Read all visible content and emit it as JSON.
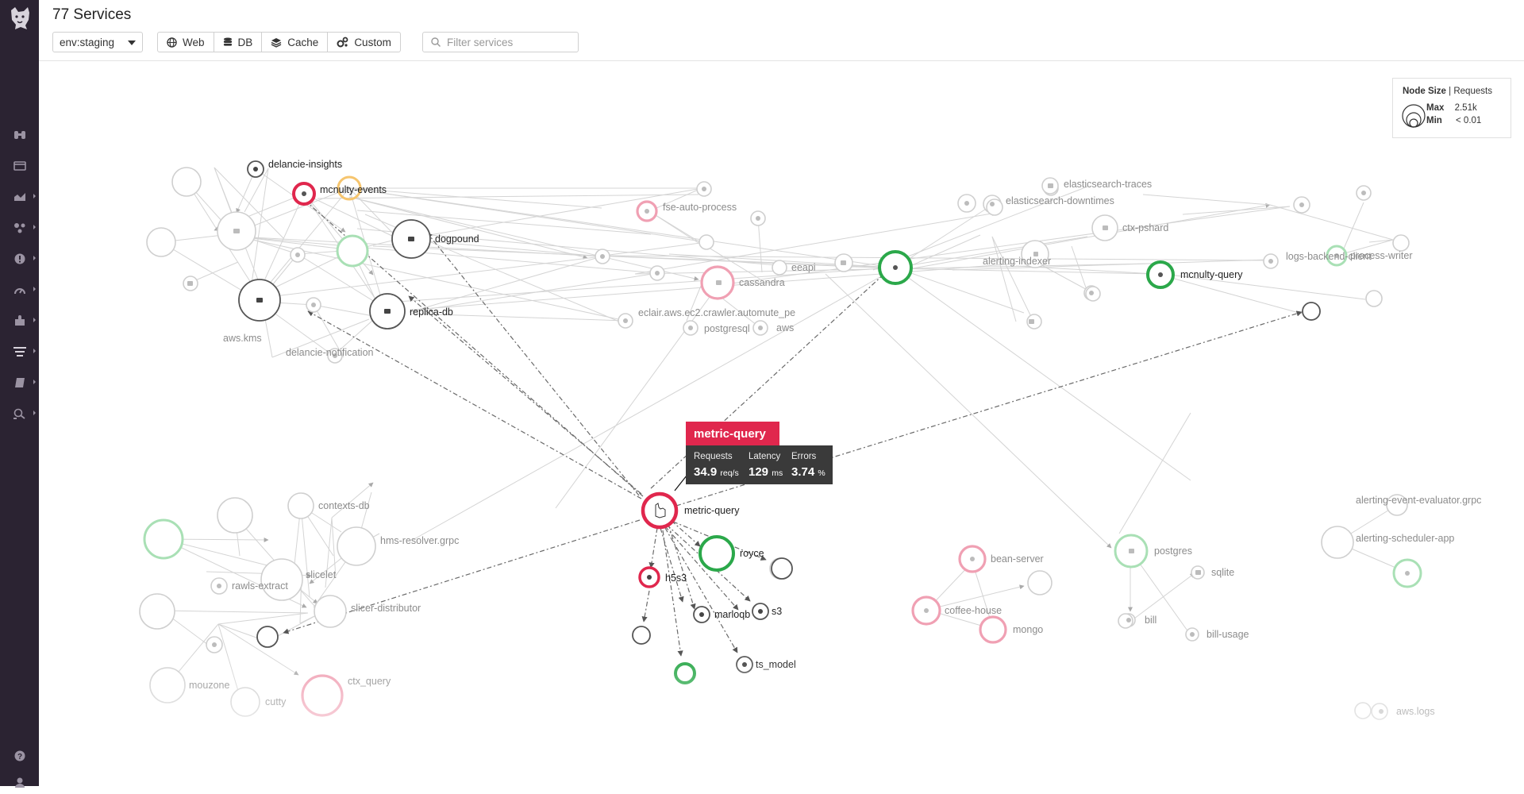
{
  "sidebar": {
    "logo": "dog-logo-icon",
    "items": [
      {
        "icon": "binoculars-icon"
      },
      {
        "icon": "dashboard-icon"
      },
      {
        "icon": "infrastructure-icon"
      },
      {
        "icon": "apm-icon"
      },
      {
        "icon": "monitors-icon"
      },
      {
        "icon": "gauge-icon"
      },
      {
        "icon": "integrations-icon"
      },
      {
        "icon": "logs-icon"
      },
      {
        "icon": "notebook-icon"
      },
      {
        "icon": "synthetics-icon"
      }
    ],
    "help_icon": "help-icon"
  },
  "header": {
    "title": "77 Services",
    "env": "env:staging",
    "filters": [
      {
        "label": "Web",
        "icon": "globe-icon"
      },
      {
        "label": "DB",
        "icon": "database-icon"
      },
      {
        "label": "Cache",
        "icon": "layers-icon"
      },
      {
        "label": "Custom",
        "icon": "gears-icon"
      }
    ],
    "search_placeholder": "Filter services"
  },
  "legend": {
    "title": "Node Size",
    "metric": "Requests",
    "max_label": "Max",
    "max_value": "2.51k",
    "min_label": "Min",
    "min_value": "< 0.01"
  },
  "tooltip": {
    "service": "metric-query",
    "requests_label": "Requests",
    "requests_value": "34.9",
    "requests_unit": "req/s",
    "latency_label": "Latency",
    "latency_value": "129",
    "latency_unit": "ms",
    "errors_label": "Errors",
    "errors_value": "3.74",
    "errors_unit": "%"
  },
  "colors": {
    "sidebar": "#2b2332",
    "red": "#e0274d",
    "green": "#2ba84a",
    "orange": "#f5b246",
    "gray": "#8c8c8c"
  },
  "nodes": [
    {
      "label": "delancie-insights",
      "type": "custom",
      "status": "neutral"
    },
    {
      "label": "mcnulty-events",
      "type": "web",
      "status": "error"
    },
    {
      "label": "dogpound",
      "type": "db",
      "status": "neutral"
    },
    {
      "label": "replica-db",
      "type": "db",
      "status": "neutral"
    },
    {
      "label": "aws.kms",
      "type": "web",
      "status": "neutral"
    },
    {
      "label": "delancie-notification",
      "type": "custom",
      "status": "neutral"
    },
    {
      "label": "fse-auto-process",
      "type": "custom",
      "status": "error"
    },
    {
      "label": "eeapi",
      "type": "custom",
      "status": "neutral"
    },
    {
      "label": "cassandra",
      "type": "db",
      "status": "error"
    },
    {
      "label": "eclair.aws.ec2.crawler.automute_pe",
      "type": "custom",
      "status": "neutral"
    },
    {
      "label": "postgresql",
      "type": "db",
      "status": "neutral"
    },
    {
      "label": "aws",
      "type": "web",
      "status": "neutral"
    },
    {
      "label": "elasticsearch-downtimes",
      "type": "custom",
      "status": "neutral"
    },
    {
      "label": "elasticsearch-traces",
      "type": "db",
      "status": "neutral"
    },
    {
      "label": "ctx-pshard",
      "type": "db",
      "status": "neutral"
    },
    {
      "label": "alerting-indexer",
      "type": "custom",
      "status": "neutral"
    },
    {
      "label": "mcnulty-query",
      "type": "web",
      "status": "ok"
    },
    {
      "label": "logs-backend-client",
      "type": "web",
      "status": "neutral"
    },
    {
      "label": "process-writer",
      "type": "custom",
      "status": "ok"
    },
    {
      "label": "metric-query",
      "type": "web",
      "status": "error"
    },
    {
      "label": "royce",
      "type": "web",
      "status": "ok"
    },
    {
      "label": "h5s3",
      "type": "custom",
      "status": "error"
    },
    {
      "label": "marloqb",
      "type": "custom",
      "status": "neutral"
    },
    {
      "label": "s3",
      "type": "custom",
      "status": "neutral"
    },
    {
      "label": "ts_model",
      "type": "custom",
      "status": "neutral"
    },
    {
      "label": "contexts-db",
      "type": "db",
      "status": "neutral"
    },
    {
      "label": "hms-resolver.grpc",
      "type": "web",
      "status": "neutral"
    },
    {
      "label": "slicelet",
      "type": "web",
      "status": "neutral"
    },
    {
      "label": "rawls-extract",
      "type": "web",
      "status": "neutral"
    },
    {
      "label": "slicer-distributor",
      "type": "web",
      "status": "neutral"
    },
    {
      "label": "mouzone",
      "type": "web",
      "status": "neutral"
    },
    {
      "label": "cutty",
      "type": "web",
      "status": "neutral"
    },
    {
      "label": "ctx_query",
      "type": "web",
      "status": "error"
    },
    {
      "label": "bean-server",
      "type": "web",
      "status": "error"
    },
    {
      "label": "coffee-house",
      "type": "web",
      "status": "error"
    },
    {
      "label": "mongo",
      "type": "db",
      "status": "error"
    },
    {
      "label": "postgres",
      "type": "db",
      "status": "ok"
    },
    {
      "label": "sqlite",
      "type": "db",
      "status": "neutral"
    },
    {
      "label": "bill",
      "type": "web",
      "status": "neutral"
    },
    {
      "label": "bill-usage",
      "type": "web",
      "status": "neutral"
    },
    {
      "label": "alerting-event-evaluator.grpc",
      "type": "web",
      "status": "neutral"
    },
    {
      "label": "alerting-scheduler-app",
      "type": "web",
      "status": "ok"
    },
    {
      "label": "aws.logs",
      "type": "web",
      "status": "neutral"
    }
  ]
}
